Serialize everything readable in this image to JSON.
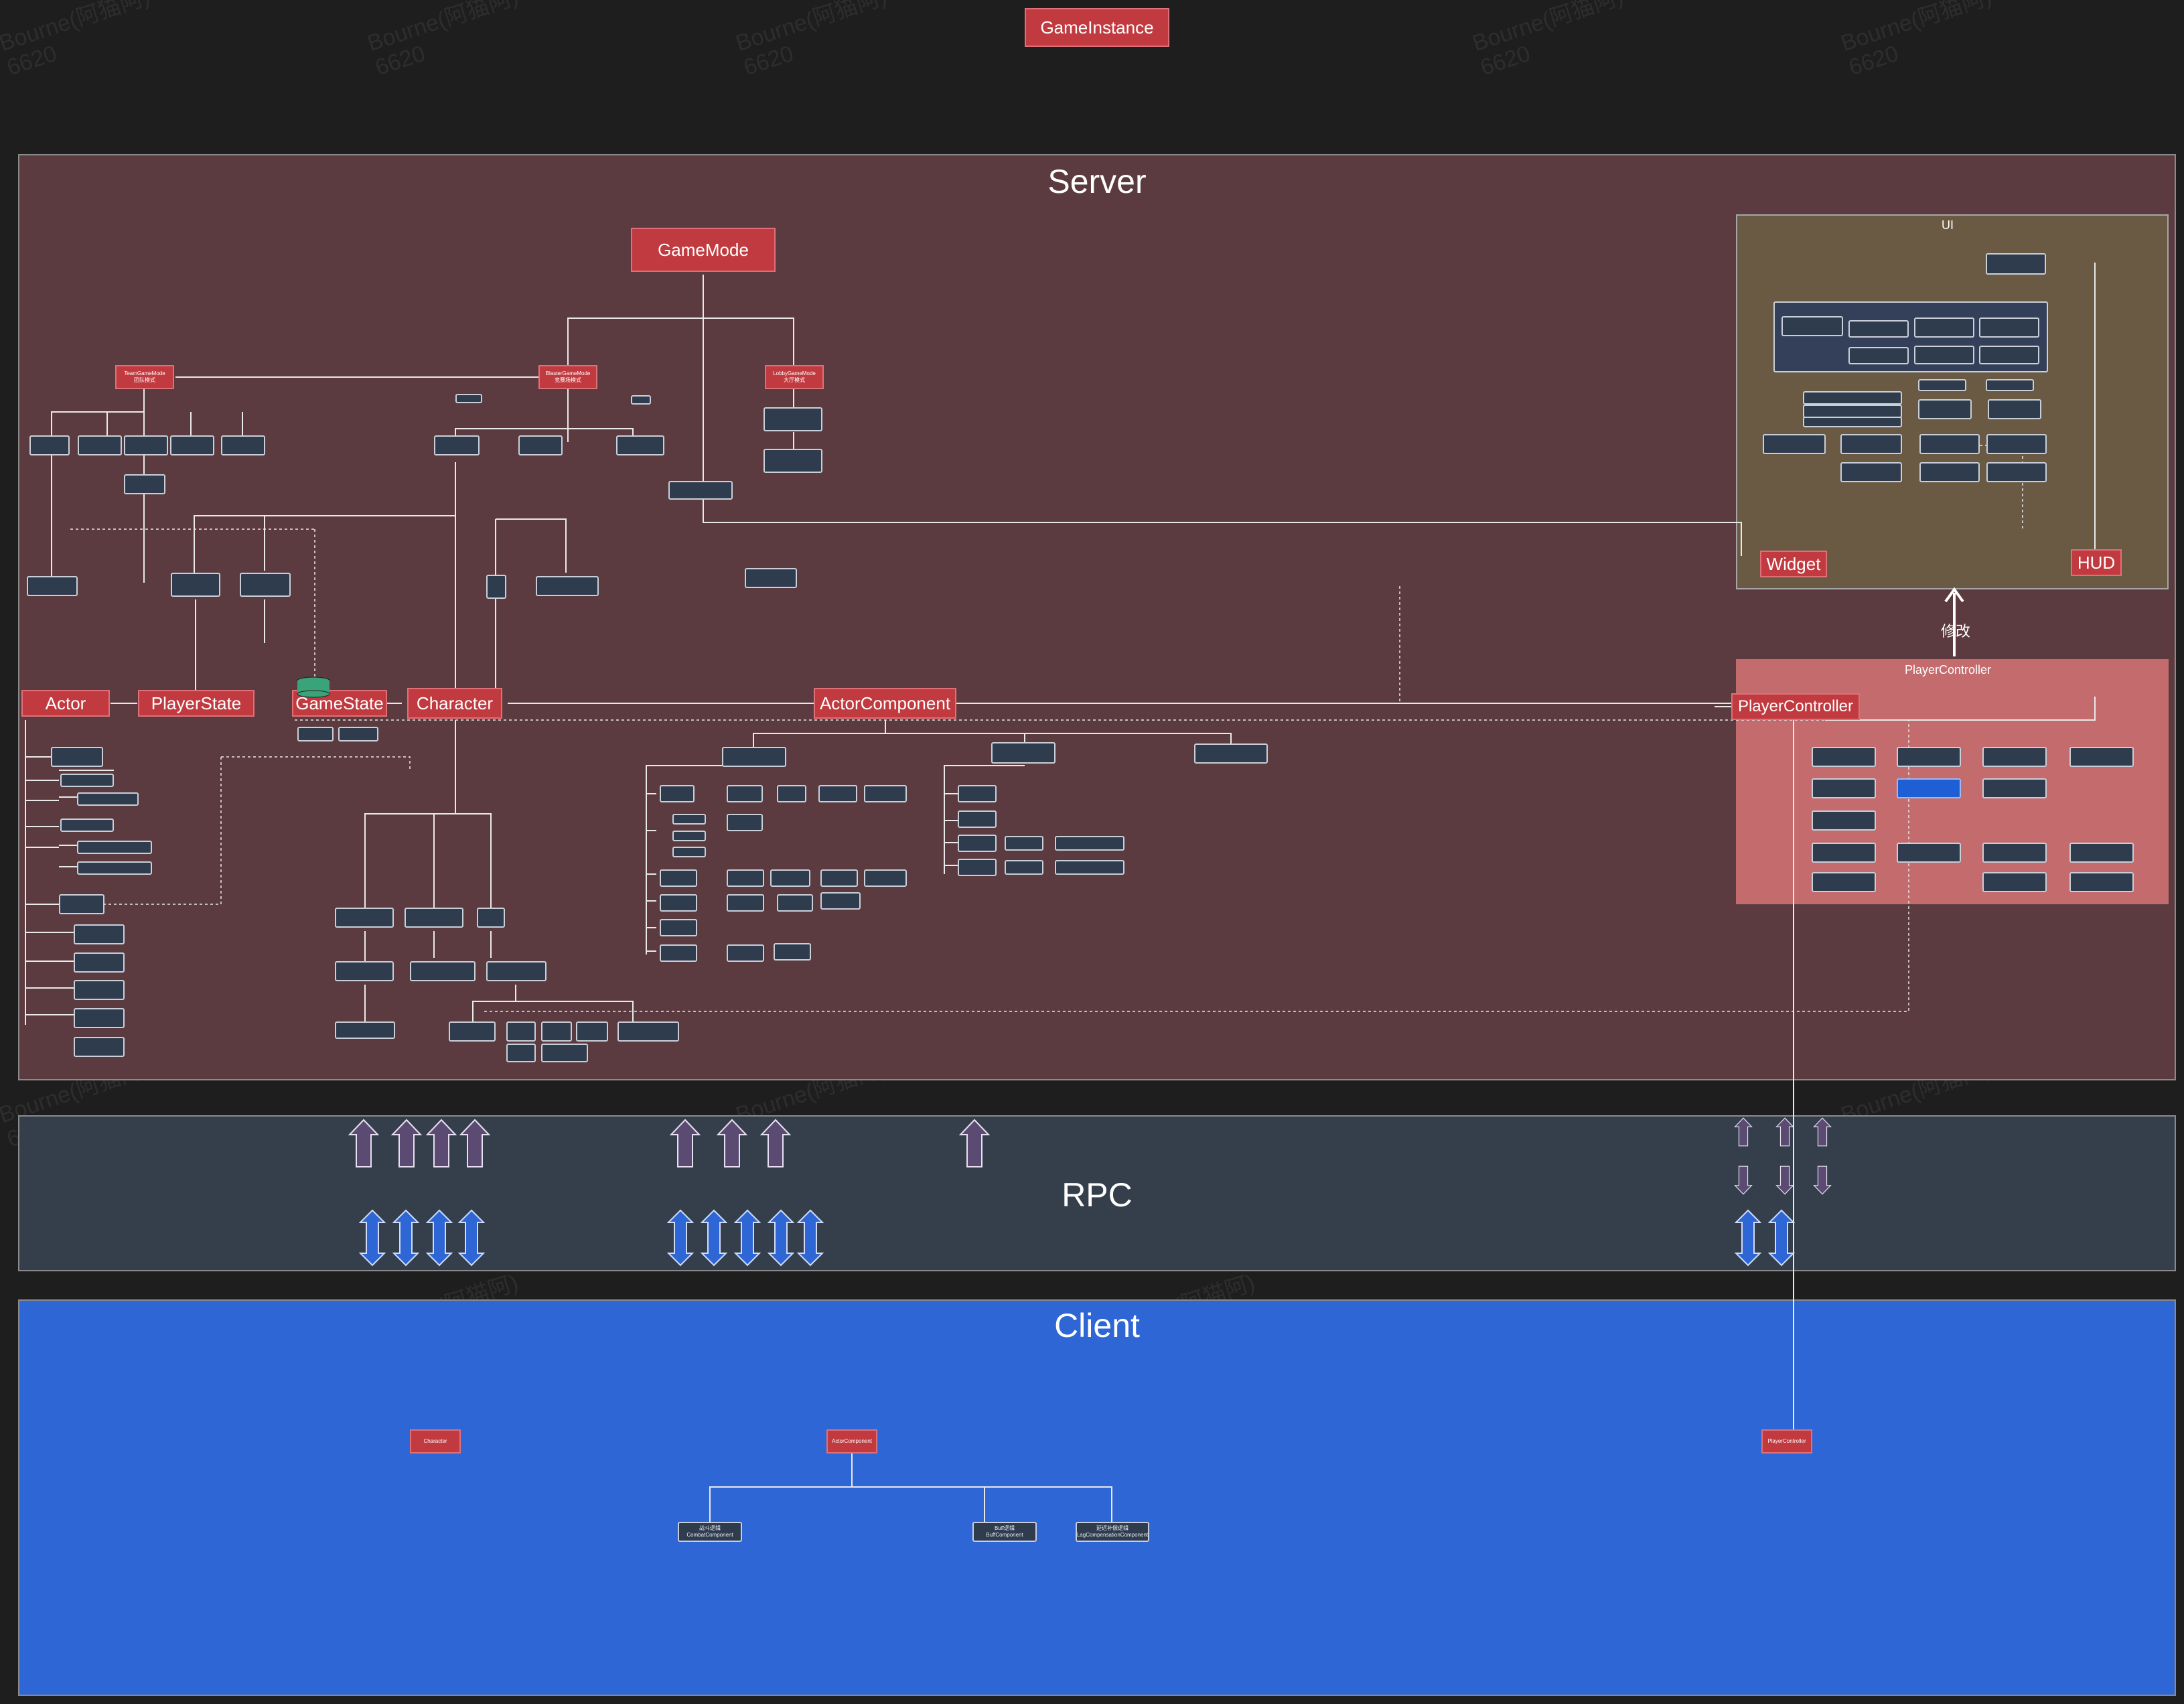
{
  "title": "GameInstance",
  "sections": {
    "server": "Server",
    "rpc": "RPC",
    "client": "Client",
    "ui": "UI",
    "player_controller_frame": "PlayerController",
    "modify": "修改"
  },
  "server_nodes": {
    "gamemode": "GameMode",
    "actor": "Actor",
    "playerstate": "PlayerState",
    "gamestate": "GameState",
    "character": "Character",
    "actorcomponent": "ActorComponent",
    "widget": "Widget",
    "hud": "HUD",
    "playercontroller": "PlayerController",
    "team_gamemode": "TeamGameMode\n团队模式",
    "blaster_gamemode": "BlasterGameMode\n竞赛场模式",
    "lobby_gamemode": "LobbyGameMode\n大厅模式"
  },
  "client_nodes": {
    "character": "Character",
    "actorcomponent": "ActorComponent",
    "playercontroller": "PlayerController",
    "combat": "战斗逻辑\nCombatComponent",
    "buff": "Buff逻辑\nBuffComponent",
    "lag": "延迟补偿逻辑\nLagCompensationComponent"
  },
  "watermark": "Bourne(阿猫阿)\n6620"
}
